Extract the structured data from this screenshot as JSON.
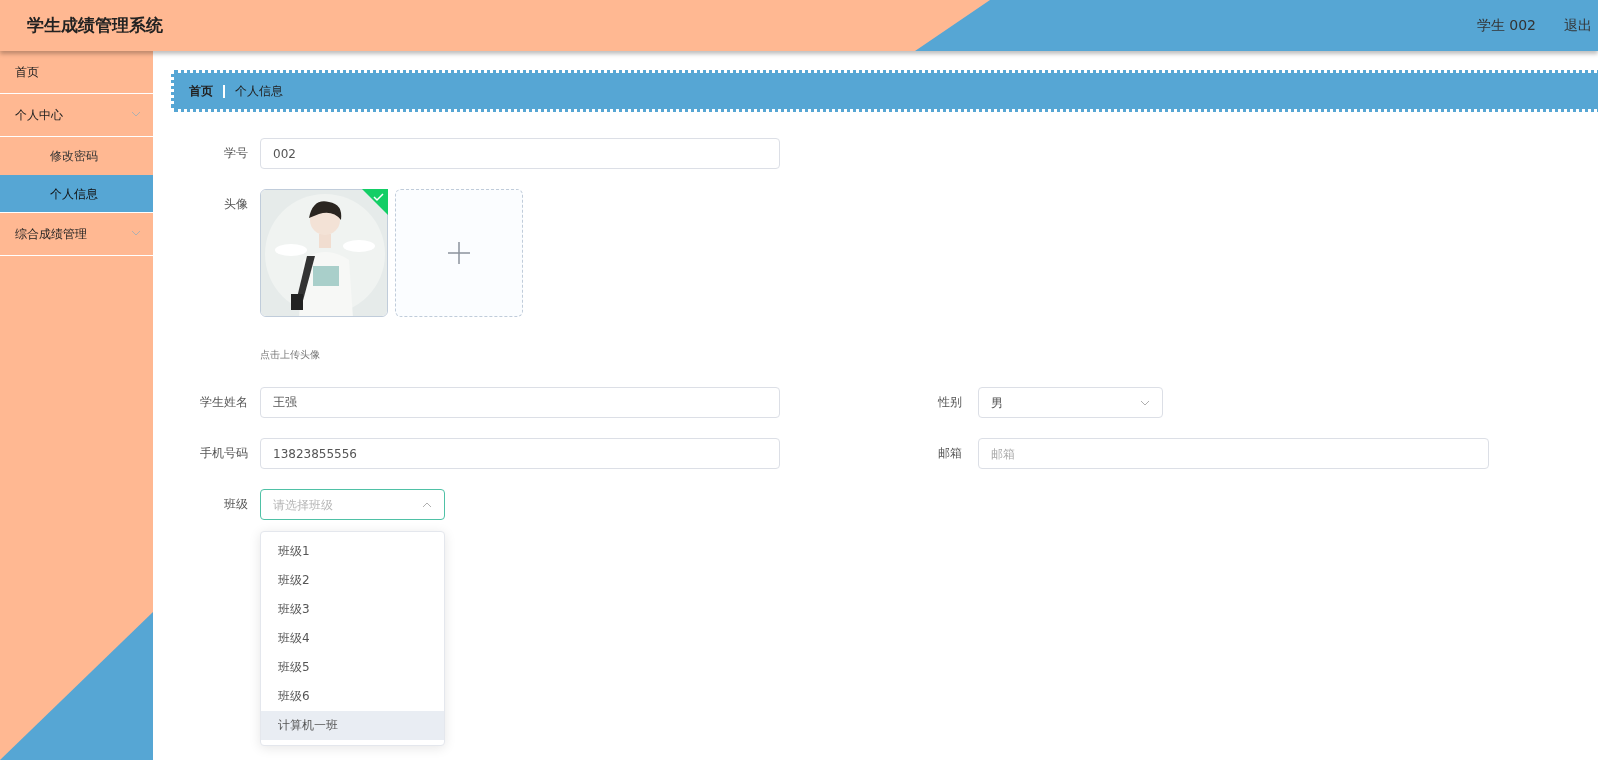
{
  "header": {
    "title": "学生成绩管理系统",
    "user": "学生 002",
    "logout": "退出"
  },
  "sidebar": {
    "items": [
      {
        "label": "首页",
        "selected": false
      },
      {
        "label": "个人中心",
        "selected": false,
        "children": [
          {
            "label": "修改密码",
            "selected": false
          },
          {
            "label": "个人信息",
            "selected": true
          }
        ]
      },
      {
        "label": "综合成绩管理",
        "selected": false,
        "submenu": true
      }
    ]
  },
  "breadcrumb": [
    "首页",
    "个人信息"
  ],
  "form": {
    "rows": [
      [
        {
          "kind": "text",
          "label": "学号",
          "value": "002"
        }
      ],
      [
        {
          "kind": "avatar",
          "label": "头像",
          "uploaded": true,
          "hint": "点击上传头像"
        }
      ],
      [
        {
          "kind": "text",
          "label": "学生姓名",
          "value": "王强"
        },
        {
          "kind": "select",
          "label": "性别",
          "value": "男",
          "open": false
        }
      ],
      [
        {
          "kind": "text",
          "label": "手机号码",
          "value": "13823855556"
        },
        {
          "kind": "text",
          "label": "邮箱",
          "placeholder": "邮箱"
        }
      ],
      [
        {
          "kind": "select",
          "label": "班级",
          "placeholder": "请选择班级",
          "open": true,
          "options": [
            {
              "label": "班级1",
              "hovered": false
            },
            {
              "label": "班级2",
              "hovered": false
            },
            {
              "label": "班级3",
              "hovered": false
            },
            {
              "label": "班级4",
              "hovered": false
            },
            {
              "label": "班级5",
              "hovered": false
            },
            {
              "label": "班级6",
              "hovered": false
            },
            {
              "label": "计算机一班",
              "hovered": true
            }
          ]
        }
      ]
    ]
  }
}
